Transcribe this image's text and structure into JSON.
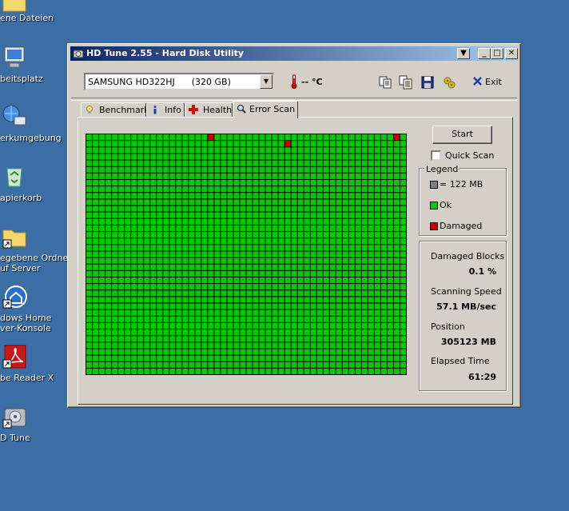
{
  "desktop_icons": [
    {
      "label_lines": [
        "ene Dateien"
      ]
    },
    {
      "label_lines": [
        "beitsplatz"
      ]
    },
    {
      "label_lines": [
        "erkumgebung"
      ]
    },
    {
      "label_lines": [
        "apierkorb"
      ]
    },
    {
      "label_lines": [
        "egebene Ordner",
        "uf Server"
      ]
    },
    {
      "label_lines": [
        "dows Home",
        "ver-Konsole"
      ]
    },
    {
      "label_lines": [
        "be Reader X"
      ]
    },
    {
      "label_lines": [
        "D Tune"
      ]
    }
  ],
  "window": {
    "title": "HD Tune 2.55 - Hard Disk Utility",
    "title_buttons": {
      "menu": "▼",
      "minimize": "_",
      "maximize": "□",
      "close": "✕"
    }
  },
  "toolbar": {
    "drive_select_value": "SAMSUNG HD322HJ      (320 GB)",
    "temperature": "-- °C",
    "exit_label": "Exit"
  },
  "tabs": [
    {
      "label": "Benchmark",
      "icon": "lightbulb-icon"
    },
    {
      "label": "Info",
      "icon": "info-icon"
    },
    {
      "label": "Health",
      "icon": "health-cross-icon"
    },
    {
      "label": "Error Scan",
      "icon": "magnifier-icon",
      "active": true
    }
  ],
  "error_scan": {
    "start_label": "Start",
    "quick_scan_label": "Quick Scan",
    "quick_scan_checked": false,
    "legend": {
      "title": "Legend",
      "items": [
        {
          "label": "= 122 MB",
          "color": "#808080"
        },
        {
          "label": "Ok",
          "color": "#00cc00"
        },
        {
          "label": "Damaged",
          "color": "#cc0000"
        }
      ]
    },
    "stats": {
      "damaged_blocks_label": "Damaged Blocks",
      "damaged_blocks_value": "0.1 %",
      "scanning_speed_label": "Scanning Speed",
      "scanning_speed_value": "57.1 MB/sec",
      "position_label": "Position",
      "position_value": "305123 MB",
      "elapsed_time_label": "Elapsed Time",
      "elapsed_time_value": "61:29"
    },
    "grid": {
      "columns": 50,
      "rows": 37,
      "ok_color": "#00cc00",
      "damaged_color": "#cc0000",
      "damaged_cells": [
        {
          "row": 0,
          "col": 19
        },
        {
          "row": 1,
          "col": 31
        },
        {
          "row": 0,
          "col": 48
        }
      ]
    }
  }
}
